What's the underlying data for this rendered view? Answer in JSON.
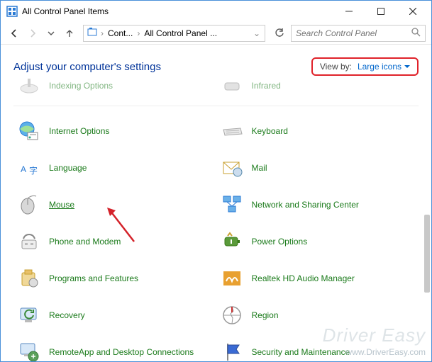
{
  "window": {
    "title": "All Control Panel Items"
  },
  "breadcrumb": {
    "seg1": "Cont...",
    "seg2": "All Control Panel ..."
  },
  "search": {
    "placeholder": "Search Control Panel"
  },
  "heading": "Adjust your computer's settings",
  "viewby": {
    "label": "View by:",
    "value": "Large icons"
  },
  "items": {
    "left": [
      {
        "label": "Indexing Options"
      },
      {
        "label": "Internet Options"
      },
      {
        "label": "Language"
      },
      {
        "label": "Mouse"
      },
      {
        "label": "Phone and Modem"
      },
      {
        "label": "Programs and Features"
      },
      {
        "label": "Recovery"
      },
      {
        "label": "RemoteApp and Desktop Connections"
      }
    ],
    "right": [
      {
        "label": "Infrared"
      },
      {
        "label": "Keyboard"
      },
      {
        "label": "Mail"
      },
      {
        "label": "Network and Sharing Center"
      },
      {
        "label": "Power Options"
      },
      {
        "label": "Realtek HD Audio Manager"
      },
      {
        "label": "Region"
      },
      {
        "label": "Security and Maintenance"
      }
    ]
  },
  "watermark": {
    "line1": "Driver Easy",
    "line2": "www.DriverEasy.com"
  }
}
